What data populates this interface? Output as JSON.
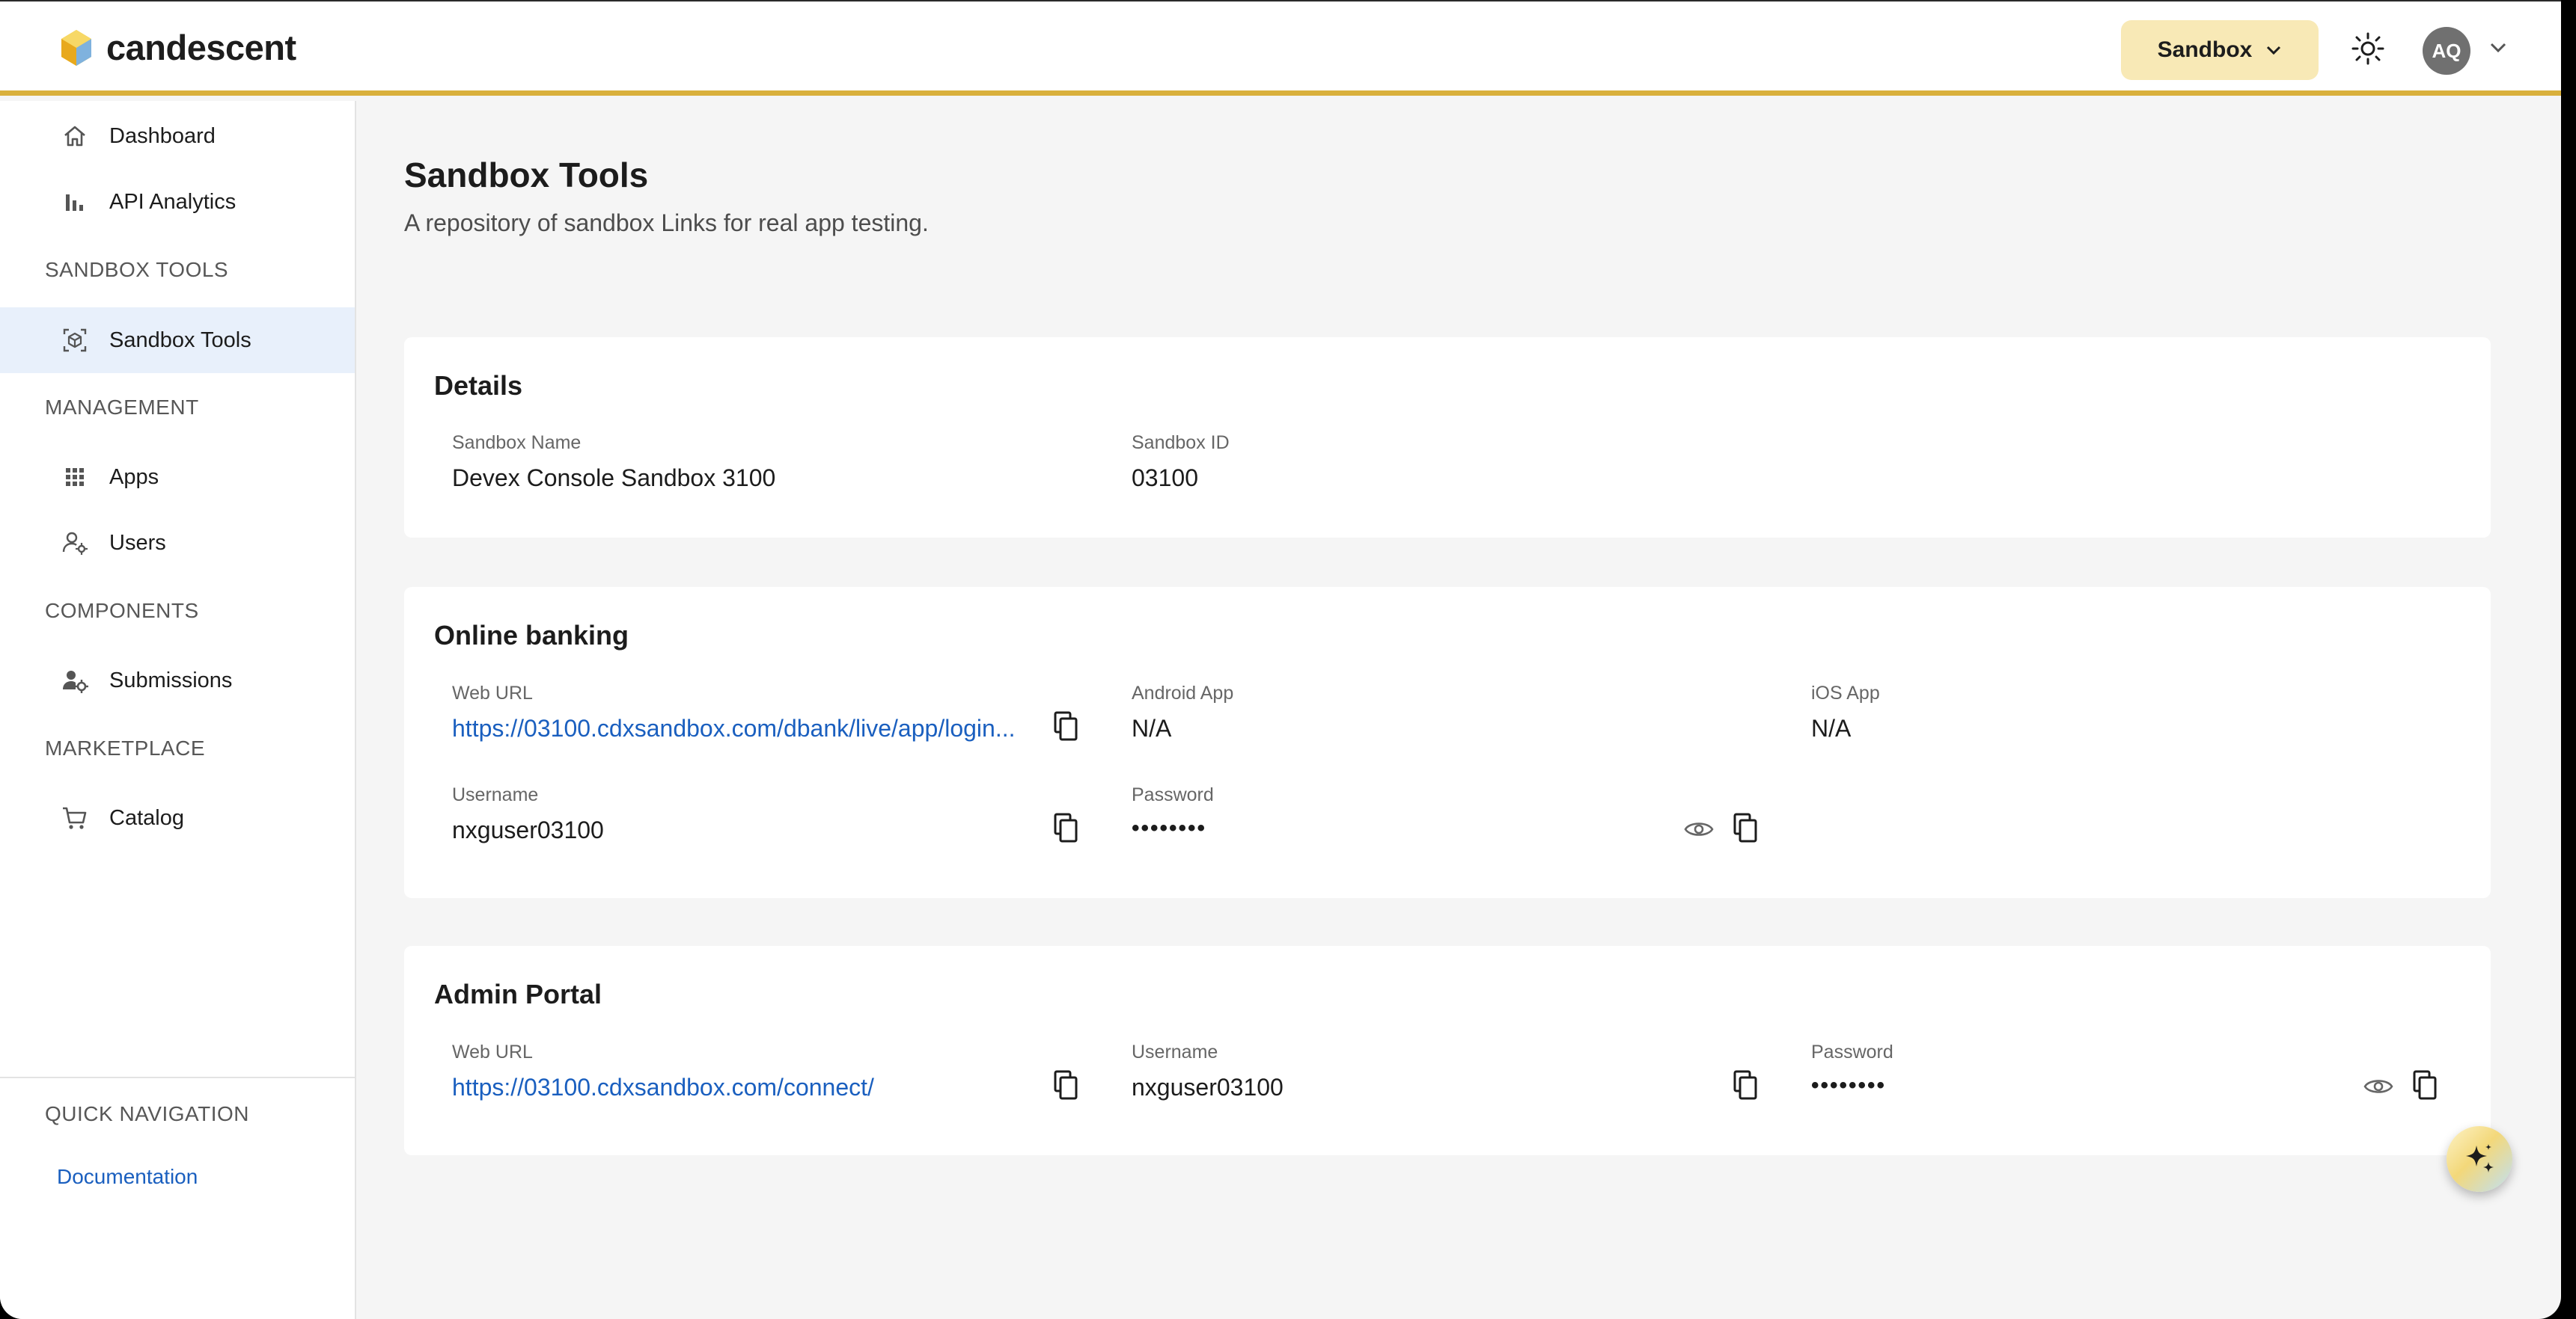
{
  "brand": {
    "name": "candescent"
  },
  "header": {
    "environment": "Sandbox",
    "avatar_initials": "AQ"
  },
  "sidebar": {
    "items_top": [
      {
        "label": "Dashboard",
        "icon": "home-icon"
      },
      {
        "label": "API Analytics",
        "icon": "bar-chart-icon"
      }
    ],
    "sections": [
      {
        "header": "SANDBOX TOOLS",
        "items": [
          {
            "label": "Sandbox Tools",
            "icon": "sandbox-cube-icon",
            "active": true
          }
        ]
      },
      {
        "header": "MANAGEMENT",
        "items": [
          {
            "label": "Apps",
            "icon": "apps-grid-icon"
          },
          {
            "label": "Users",
            "icon": "users-gear-icon"
          }
        ]
      },
      {
        "header": "COMPONENTS",
        "items": [
          {
            "label": "Submissions",
            "icon": "submissions-icon"
          }
        ]
      },
      {
        "header": "MARKETPLACE",
        "items": [
          {
            "label": "Catalog",
            "icon": "cart-icon"
          }
        ]
      }
    ],
    "quick_nav": {
      "header": "QUICK NAVIGATION",
      "link": "Documentation"
    }
  },
  "page": {
    "title": "Sandbox Tools",
    "subtitle": "A repository of sandbox Links for real app testing."
  },
  "details": {
    "title": "Details",
    "name_label": "Sandbox Name",
    "name_value": "Devex Console Sandbox 3100",
    "id_label": "Sandbox ID",
    "id_value": "03100"
  },
  "online_banking": {
    "title": "Online banking",
    "web_url_label": "Web URL",
    "web_url_value": "https://03100.cdxsandbox.com/dbank/live/app/login...",
    "android_label": "Android App",
    "android_value": "N/A",
    "ios_label": "iOS App",
    "ios_value": "N/A",
    "username_label": "Username",
    "username_value": "nxguser03100",
    "password_label": "Password",
    "password_value": "••••••••"
  },
  "admin_portal": {
    "title": "Admin Portal",
    "web_url_label": "Web URL",
    "web_url_value": "https://03100.cdxsandbox.com/connect/",
    "username_label": "Username",
    "username_value": "nxguser03100",
    "password_label": "Password",
    "password_value": "••••••••"
  },
  "colors": {
    "accent": "#d9b03c",
    "link": "#1a5fbf",
    "env_button": "#f8e9b6",
    "active_nav": "#e8f0fb"
  }
}
